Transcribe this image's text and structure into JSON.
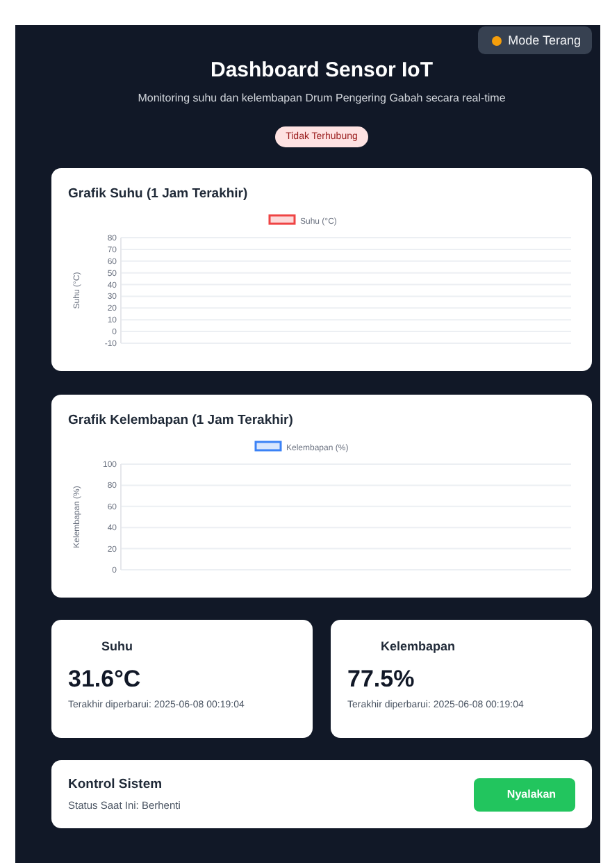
{
  "theme_toggle": {
    "label": "Mode Terang"
  },
  "header": {
    "title": "Dashboard Sensor IoT",
    "subtitle": "Monitoring suhu dan kelembapan Drum Pengering Gabah secara real-time"
  },
  "connection_status": {
    "label": "Tidak Terhubung",
    "connected": false
  },
  "charts": [
    {
      "title": "Grafik Suhu (1 Jam Terakhir)",
      "chart_data": {
        "type": "line",
        "ylabel": "Suhu (°C)",
        "grid": true,
        "ylim": [
          -10,
          80
        ],
        "yticks": [
          80,
          70,
          60,
          50,
          40,
          30,
          20,
          10,
          0,
          -10
        ],
        "series": [
          {
            "name": "Suhu (°C)",
            "color": "#ef4444"
          }
        ]
      }
    },
    {
      "title": "Grafik Kelembapan (1 Jam Terakhir)",
      "chart_data": {
        "type": "line",
        "ylabel": "Kelembapan (%)",
        "grid": true,
        "ylim": [
          0,
          100
        ],
        "yticks": [
          100,
          80,
          60,
          40,
          20,
          0
        ],
        "series": [
          {
            "name": "Kelembapan (%)",
            "color": "#3b82f6"
          }
        ]
      }
    }
  ],
  "readings": [
    {
      "label": "Suhu",
      "value": "31.6°C",
      "updated": "Terakhir diperbarui: 2025-06-08 00:19:04"
    },
    {
      "label": "Kelembapan",
      "value": "77.5%",
      "updated": "Terakhir diperbarui: 2025-06-08 00:19:04"
    }
  ],
  "control": {
    "title": "Kontrol Sistem",
    "status": "Status Saat Ini: Berhenti",
    "button": "Nyalakan",
    "running": false
  }
}
